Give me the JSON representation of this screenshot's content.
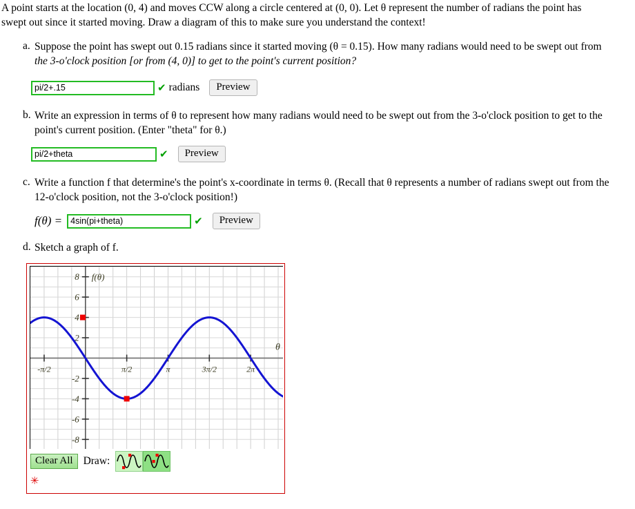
{
  "problem": {
    "intro_line1": "A point starts at the location (0, 4) and moves CCW along a circle centered at (0, 0). Let θ represent the number of radians the point has",
    "intro_line2": "swept out since it started moving. Draw a diagram of this to make sure you understand the context!"
  },
  "parts": [
    {
      "label": "a.",
      "text_line1": "Suppose the point has swept out 0.15 radians since it started moving (θ = 0.15). How many radians would need to be swept out from",
      "text_line2": "the 3-o'clock position [or from (4, 0)] to get to the point's current position?",
      "answer": {
        "value": "pi/2+.15",
        "placeholder": "",
        "status_icon": "check-icon",
        "unit": "radians",
        "preview_label": "Preview"
      }
    },
    {
      "label": "b.",
      "text_line1": "Write an expression in terms of θ to represent how many radians would need to be swept out from the 3-o'clock position to get to the",
      "text_line2": "point's current position. (Enter \"theta\" for θ.)",
      "answer": {
        "value": "pi/2+theta",
        "placeholder": "",
        "status_icon": "check-icon",
        "unit": "",
        "preview_label": "Preview"
      }
    },
    {
      "label": "c.",
      "text_line1": "Write a function f that determine's the point's x-coordinate in terms θ. (Recall that θ represents a number of radians swept out from the",
      "text_line2": "12-o'clock position, not the 3-o'clock position!)",
      "answer": {
        "prefix": "f(θ)  =",
        "value": "4sin(pi+theta)",
        "placeholder": "",
        "status_icon": "check-icon",
        "unit": "",
        "preview_label": "Preview"
      }
    },
    {
      "label": "d.",
      "text_line1": "Sketch a graph of f.",
      "text_line2": ""
    }
  ],
  "graph_tool": {
    "clear_label": "Clear All",
    "draw_label": "Draw:",
    "tools": [
      {
        "name": "sine-tool-unselected",
        "selected": false
      },
      {
        "name": "sine-tool-selected",
        "selected": true
      }
    ],
    "marker_icon": "red-asterisk-icon"
  },
  "chart_data": {
    "type": "line",
    "title": "",
    "xlabel": "θ",
    "ylabel": "f(θ)",
    "xlim": [
      -2.0943951,
      7.5398224
    ],
    "ylim": [
      -9.0,
      9.0
    ],
    "grid": true,
    "grid_x_step_radians": 0.5235988,
    "grid_y_step": 1,
    "x_ticks": [
      {
        "value": -1.5707963,
        "label": "-π/2"
      },
      {
        "value": 1.5707963,
        "label": "π/2"
      },
      {
        "value": 3.1415927,
        "label": "π"
      },
      {
        "value": 4.712389,
        "label": "3π/2"
      },
      {
        "value": 6.2831853,
        "label": "2π"
      }
    ],
    "y_ticks": [
      {
        "value": 8,
        "label": "8"
      },
      {
        "value": 6,
        "label": "6"
      },
      {
        "value": 4,
        "label": "4"
      },
      {
        "value": 2,
        "label": "2"
      },
      {
        "value": -2,
        "label": "-2"
      },
      {
        "value": -4,
        "label": "-4"
      },
      {
        "value": -6,
        "label": "-6"
      },
      {
        "value": -8,
        "label": "-8"
      }
    ],
    "series": [
      {
        "name": "f",
        "expression": "4*sin(pi+theta)",
        "amplitude": 4,
        "period": 6.2831853,
        "phase_shift": 3.1415927,
        "color": "#1414d2",
        "line_width": 3
      }
    ],
    "control_points": [
      {
        "x": -0.1,
        "y": 4,
        "color": "#ee0000"
      },
      {
        "x": 1.5707963,
        "y": -4,
        "color": "#ee0000"
      }
    ]
  }
}
